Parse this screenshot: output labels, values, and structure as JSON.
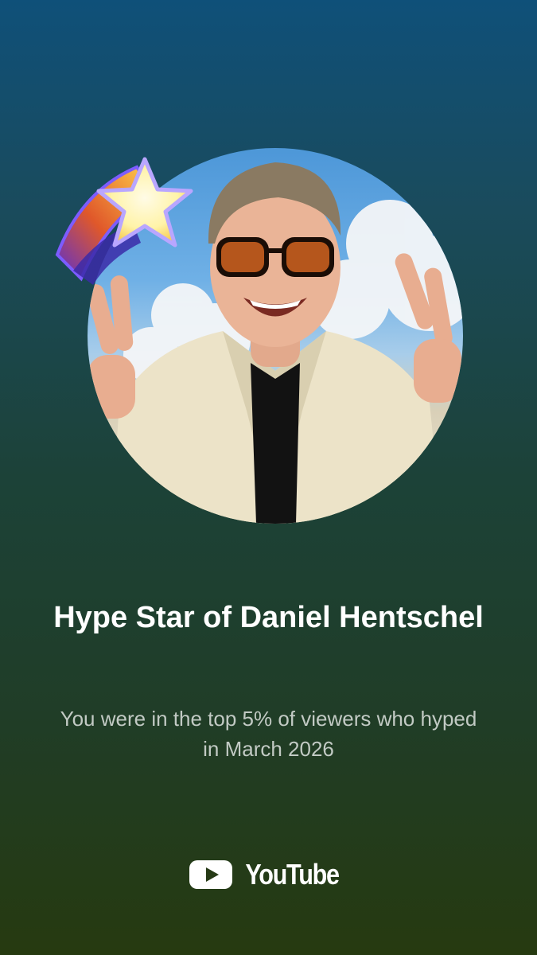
{
  "card": {
    "title": "Hype Star of Daniel Hentschel",
    "subtitle": "You were in the top 5% of viewers who hyped in March 2026"
  },
  "brand": {
    "name": "YouTube",
    "icon": "youtube-play-logo",
    "logo_red": "#ffffff"
  },
  "badge": {
    "icon": "shooting-star-icon"
  },
  "colors": {
    "background_top": "#0f5079",
    "background_bottom": "#263a10",
    "title": "#ffffff",
    "subtitle": "#c2cac4"
  }
}
